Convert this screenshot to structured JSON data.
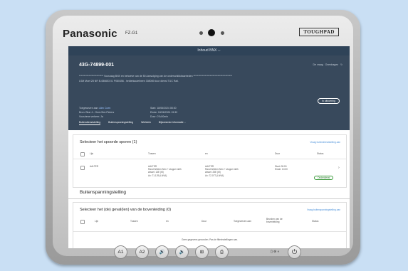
{
  "device": {
    "brand": "Panasonic",
    "model": "FZ-G1",
    "badge": "TOUGHPAD"
  },
  "app": {
    "topbar": "Inhoud BNX ⌵",
    "id": "43G-74899-001",
    "actions": [
      "De vraag",
      "Overdragen",
      "↻"
    ],
    "description": "************************* Voorzaag BNX en behoeve van de 50 Aanvulging van de onderschikkbaarheden ****************************************",
    "description2": "LSM Moet 28 NR B-086653 01 P080456 - helderkautelheen 308069 door dienst TUC Rail.",
    "status_badge": "In uitvoering",
    "meta_left": [
      {
        "label": "Toegewezen aan:",
        "value": "Alex Coen"
      },
      {
        "label": "Bron: Blue 4 - Gent-Sint-Pieters",
        "value": ""
      },
      {
        "label": "Voorziene verkeer: Ja",
        "value": ""
      }
    ],
    "meta_right": [
      "Start: 18/06/2024 08:30",
      "Einde: 18/06/2024 15:30",
      "Duur: 07u00min"
    ],
    "tabs": [
      "Buitendienststelling",
      "Buitenspanningstelling",
      "Werktein",
      "Bijkomende informatie ⌵"
    ]
  },
  "section1": {
    "title": "Selecteer het spoorde sporen (1)",
    "link": "Vraag buitendienststelling aan",
    "headers": [
      "Lijn",
      "Tussen",
      "en",
      "Duur",
      "Status"
    ],
    "row": {
      "line": "AALTER",
      "between": [
        "AALTER",
        "Rand Wotten Sein + stopper stilh",
        "wissel: 13E (M)",
        "Ax: 71.129 (LNVA)"
      ],
      "and": [
        "AALTER",
        "Rand Wotten Sein + stopper stilh",
        "wissel: 25E (M)",
        "Ax: 72.077 (LNVA)"
      ],
      "duration": [
        "Start: 08:00",
        "Einde: 10:00"
      ],
      "status": "Onderdienst",
      "chevron": "›"
    }
  },
  "section2": {
    "heading": "Buitenspanningstelling",
    "title": "Selecteer het (de) geval(len) van de bovenleiding (0)",
    "link": "Vraag buitenspanningstelling aan",
    "headers": [
      "Lijn",
      "Tussen",
      "en",
      "Duur",
      "Toegewezen aan",
      "Bevolen van de bovenleiding",
      "Status"
    ],
    "empty": "Geen gegevens gevonden. Pas de filterinstellingen aan."
  },
  "hw_buttons": [
    "A1",
    "A2",
    "🔊",
    "🔉",
    "⊞",
    "⎙"
  ],
  "leds": "▯ ⊜ ◐",
  "power": "⏻"
}
